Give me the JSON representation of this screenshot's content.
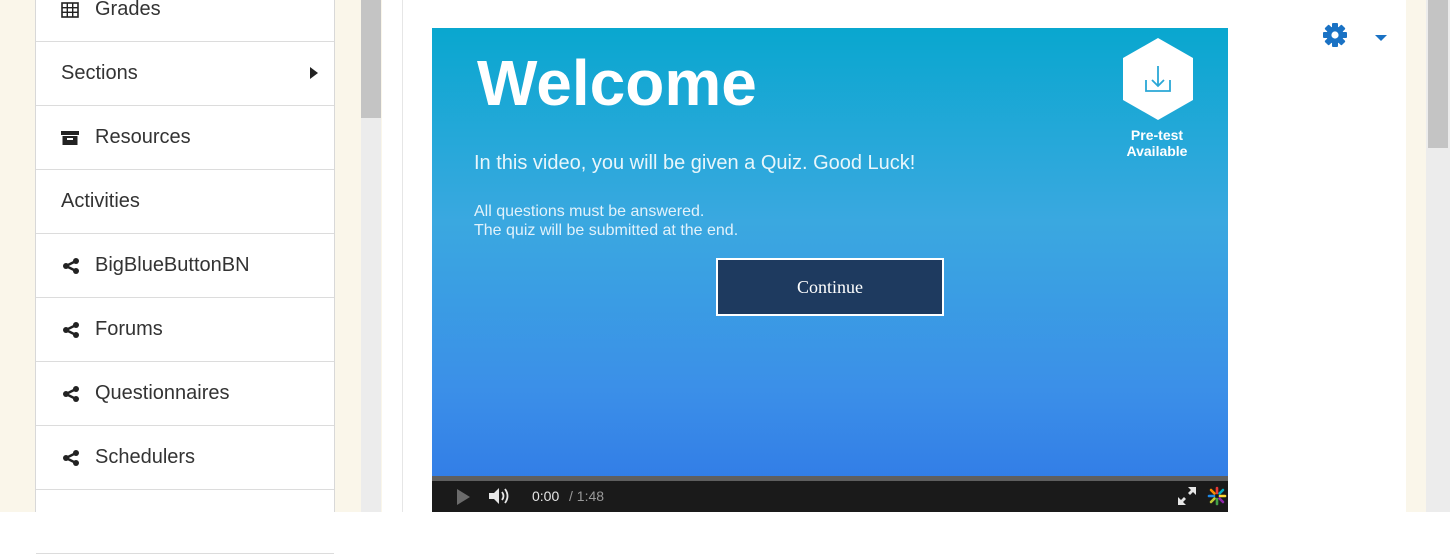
{
  "sidebar": {
    "items": [
      {
        "label": "Grades",
        "icon": "grid-icon"
      },
      {
        "label": "Sections",
        "icon": ""
      },
      {
        "label": "Resources",
        "icon": "archive-icon"
      },
      {
        "label": "Activities",
        "icon": ""
      },
      {
        "label": "BigBlueButtonBN",
        "icon": "share-icon"
      },
      {
        "label": "Forums",
        "icon": "share-icon"
      },
      {
        "label": "Questionnaires",
        "icon": "share-icon"
      },
      {
        "label": "Schedulers",
        "icon": "share-icon"
      }
    ]
  },
  "header": {
    "settings_icon": "gear-icon",
    "accent_color": "#1a72c4"
  },
  "video": {
    "title": "Welcome",
    "subtitle": "In this video, you will be given a Quiz. Good Luck!",
    "line1": "All questions must be answered.",
    "line2": "The quiz will be submitted at the end.",
    "continue_label": "Continue",
    "pretest_line1": "Pre-test",
    "pretest_line2": "Available",
    "time_current": "0:00",
    "time_total": "/ 1:48"
  }
}
